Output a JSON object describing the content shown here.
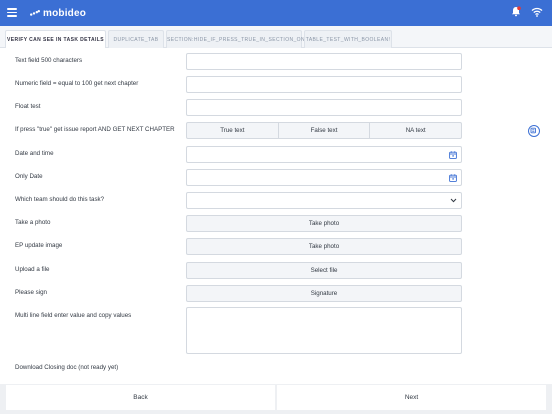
{
  "app": {
    "brand": "mobideo"
  },
  "tabs": [
    {
      "label": "VERIFY CAN SEE IN TASK DETAILS"
    },
    {
      "label": "DUPLICATE_TAB"
    },
    {
      "label": "SECTION:HIDE_IF_PRESS_TRUE_IN_SECTION_ONE"
    },
    {
      "label": "TABLE_TEST_WITH_BOOLEAN!"
    }
  ],
  "form": {
    "text500": {
      "label": "Text field 500 characters",
      "value": ""
    },
    "numeric": {
      "label": "Numeric field = equal to 100 get next chapter",
      "value": ""
    },
    "float": {
      "label": "Float test",
      "value": ""
    },
    "truefalse": {
      "label": "If press \"true\" get issue report AND GET NEXT CHAPTER",
      "options": [
        "True text",
        "False text",
        "NA text"
      ]
    },
    "datetime": {
      "label": "Date and time",
      "value": ""
    },
    "onlydate": {
      "label": "Only Date",
      "value": ""
    },
    "team": {
      "label": "Which team should do this task?",
      "value": ""
    },
    "photo": {
      "label": "Take a photo",
      "button": "Take photo"
    },
    "ep_image": {
      "label": "EP update image",
      "button": "Take photo"
    },
    "upload": {
      "label": "Upload a file",
      "button": "Select file"
    },
    "sign": {
      "label": "Please sign",
      "button": "Signature"
    },
    "multiline": {
      "label": "Multi line field enter value and copy values",
      "value": ""
    },
    "download": {
      "label": "Download Closing doc (not ready yet)"
    }
  },
  "footer": {
    "back": "Back",
    "next": "Next"
  },
  "colors": {
    "accent": "#3b6fd4"
  },
  "icons": [
    "menu-icon",
    "logo-icon",
    "bell-icon",
    "wifi-icon",
    "calendar-icon",
    "chevron-down-icon",
    "issue-report-icon"
  ]
}
